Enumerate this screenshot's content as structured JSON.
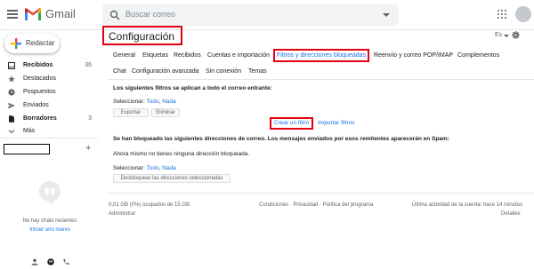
{
  "header": {
    "app_name": "Gmail",
    "search_placeholder": "Buscar correo"
  },
  "sidebar": {
    "compose_label": "Redactar",
    "items": [
      {
        "label": "Recibidos",
        "count": "36",
        "bold": true,
        "icon": "inbox-icon"
      },
      {
        "label": "Destacados",
        "count": "",
        "bold": false,
        "icon": "star-icon"
      },
      {
        "label": "Pospuestos",
        "count": "",
        "bold": false,
        "icon": "clock-icon"
      },
      {
        "label": "Enviados",
        "count": "",
        "bold": false,
        "icon": "send-icon"
      },
      {
        "label": "Borradores",
        "count": "3",
        "bold": true,
        "icon": "draft-icon"
      },
      {
        "label": "Más",
        "count": "",
        "bold": false,
        "icon": "chevron-down-icon"
      }
    ],
    "chat_add_symbol": "+",
    "no_chats_text": "No hay chats recientes",
    "start_new_link": "Iniciar uno nuevo"
  },
  "main": {
    "title": "Configuración",
    "language": "Es",
    "tabs_row1": [
      "General",
      "Etiquetas",
      "Recibidos",
      "Cuentas e importación",
      "Filtros y direcciones bloqueadas",
      "Reenvío y correo POP/IMAP",
      "Complementos"
    ],
    "tabs_row2": [
      "Chat",
      "Configuración avanzada",
      "Sin conexión",
      "Temas"
    ],
    "active_tab": "Filtros y direcciones bloqueadas",
    "filters": {
      "heading": "Los siguientes filtros se aplican a todo el correo entrante:",
      "select_label": "Seleccionar:",
      "select_all": "Todo",
      "select_separator": ", ",
      "select_none": "Nada",
      "export_button": "Exportar",
      "delete_button": "Eliminar",
      "create_filter_link": "Crear un filtro",
      "import_filters_link": "Importar filtros"
    },
    "blocked": {
      "heading": "Se han bloqueado las siguientes direcciones de correo. Los mensajes enviados por esos remitentes aparecerán en Spam:",
      "empty_text": "Ahora mismo no tienes ninguna dirección bloqueada.",
      "select_label": "Seleccionar:",
      "select_all": "Todo",
      "select_separator": ", ",
      "select_none": "Nada",
      "unblock_button": "Desbloquear las direcciones seleccionadas"
    },
    "footer": {
      "storage": "0,01 GB (0%) ocupados de 15 GB",
      "manage": "Administrar",
      "links": "Condiciones · Privacidad · Política del programa",
      "last_activity": "Última actividad de la cuenta: hace 14 minutos",
      "details": "Detalles"
    }
  },
  "colors": {
    "accent": "#1a73e8",
    "highlight_box": "#e3000f",
    "gmail_red": "#ea4335"
  }
}
